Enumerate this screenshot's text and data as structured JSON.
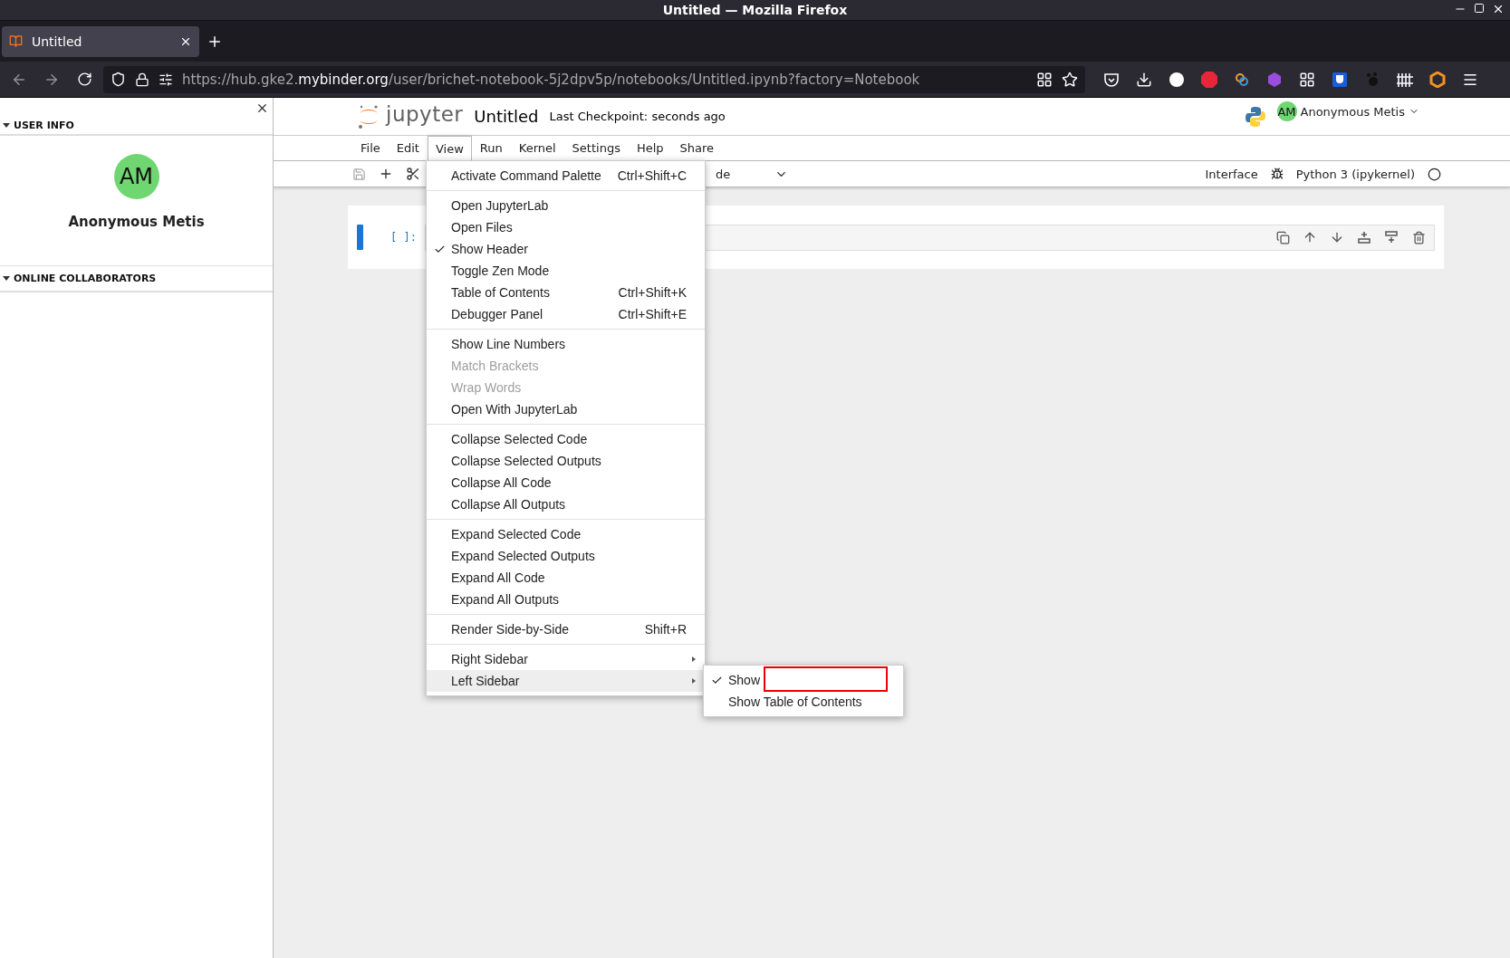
{
  "window": {
    "title": "Untitled — Mozilla Firefox"
  },
  "browser": {
    "tab": {
      "title": "Untitled",
      "selected": true
    },
    "url": {
      "prefix": "https://hub.gke2.",
      "domain": "mybinder.org",
      "path": "/user/brichet-notebook-5j2dpv5p/notebooks/Untitled.ipynb?factory=Notebook"
    }
  },
  "sidebar": {
    "sections": [
      {
        "title": "USER INFO",
        "expanded": true
      },
      {
        "title": "ONLINE COLLABORATORS",
        "expanded": true
      }
    ],
    "user": {
      "initials": "AM",
      "name": "Anonymous Metis",
      "color": "#6fd672"
    }
  },
  "header": {
    "logo": "jupyter",
    "title": "Untitled",
    "checkpoint": "Last Checkpoint: seconds ago",
    "user": {
      "initials": "AM",
      "name": "Anonymous Metis"
    }
  },
  "menubar": [
    {
      "label": "File",
      "selected": false
    },
    {
      "label": "Edit",
      "selected": false
    },
    {
      "label": "View",
      "selected": true
    },
    {
      "label": "Run",
      "selected": false
    },
    {
      "label": "Kernel",
      "selected": false
    },
    {
      "label": "Settings",
      "selected": false
    },
    {
      "label": "Help",
      "selected": false
    },
    {
      "label": "Share",
      "selected": false
    }
  ],
  "toolbar": {
    "cell_type": "de",
    "interface": "Interface",
    "kernel": "Python 3 (ipykernel)"
  },
  "cell": {
    "prompt": "[ ]:"
  },
  "view_menu": [
    [
      {
        "label": "Activate Command Palette",
        "shortcut": "Ctrl+Shift+C",
        "kind": "command",
        "checked": false,
        "disabled": false,
        "selected": false
      }
    ],
    [
      {
        "label": "Open JupyterLab",
        "kind": "command",
        "checked": false,
        "disabled": false,
        "selected": false
      },
      {
        "label": "Open Files",
        "kind": "command",
        "checked": false,
        "disabled": false,
        "selected": false
      },
      {
        "label": "Show Header",
        "kind": "command",
        "checked": true,
        "disabled": false,
        "selected": false
      },
      {
        "label": "Toggle Zen Mode",
        "kind": "command",
        "checked": false,
        "disabled": false,
        "selected": false
      },
      {
        "label": "Table of Contents",
        "shortcut": "Ctrl+Shift+K",
        "kind": "command",
        "checked": false,
        "disabled": false,
        "selected": false
      },
      {
        "label": "Debugger Panel",
        "shortcut": "Ctrl+Shift+E",
        "kind": "command",
        "checked": false,
        "disabled": false,
        "selected": false
      }
    ],
    [
      {
        "label": "Show Line Numbers",
        "kind": "command",
        "checked": false,
        "disabled": false,
        "selected": false
      },
      {
        "label": "Match Brackets",
        "kind": "command",
        "checked": false,
        "disabled": true,
        "selected": false
      },
      {
        "label": "Wrap Words",
        "kind": "command",
        "checked": false,
        "disabled": true,
        "selected": false
      },
      {
        "label": "Open With JupyterLab",
        "kind": "command",
        "checked": false,
        "disabled": false,
        "selected": false
      }
    ],
    [
      {
        "label": "Collapse Selected Code",
        "kind": "command",
        "checked": false,
        "disabled": false,
        "selected": false
      },
      {
        "label": "Collapse Selected Outputs",
        "kind": "command",
        "checked": false,
        "disabled": false,
        "selected": false
      },
      {
        "label": "Collapse All Code",
        "kind": "command",
        "checked": false,
        "disabled": false,
        "selected": false
      },
      {
        "label": "Collapse All Outputs",
        "kind": "command",
        "checked": false,
        "disabled": false,
        "selected": false
      }
    ],
    [
      {
        "label": "Expand Selected Code",
        "kind": "command",
        "checked": false,
        "disabled": false,
        "selected": false
      },
      {
        "label": "Expand Selected Outputs",
        "kind": "command",
        "checked": false,
        "disabled": false,
        "selected": false
      },
      {
        "label": "Expand All Code",
        "kind": "command",
        "checked": false,
        "disabled": false,
        "selected": false
      },
      {
        "label": "Expand All Outputs",
        "kind": "command",
        "checked": false,
        "disabled": false,
        "selected": false
      }
    ],
    [
      {
        "label": "Render Side-by-Side",
        "shortcut": "Shift+R",
        "kind": "command",
        "checked": false,
        "disabled": false,
        "selected": false
      }
    ],
    [
      {
        "label": "Right Sidebar",
        "kind": "submenu",
        "checked": false,
        "disabled": false,
        "selected": false
      },
      {
        "label": "Left Sidebar",
        "kind": "submenu",
        "checked": false,
        "disabled": false,
        "selected": true
      }
    ]
  ],
  "left_sidebar_submenu": [
    {
      "label": "Show",
      "checked": true,
      "selected": false
    },
    {
      "label": "Show Table of Contents",
      "checked": false,
      "selected": false
    }
  ]
}
